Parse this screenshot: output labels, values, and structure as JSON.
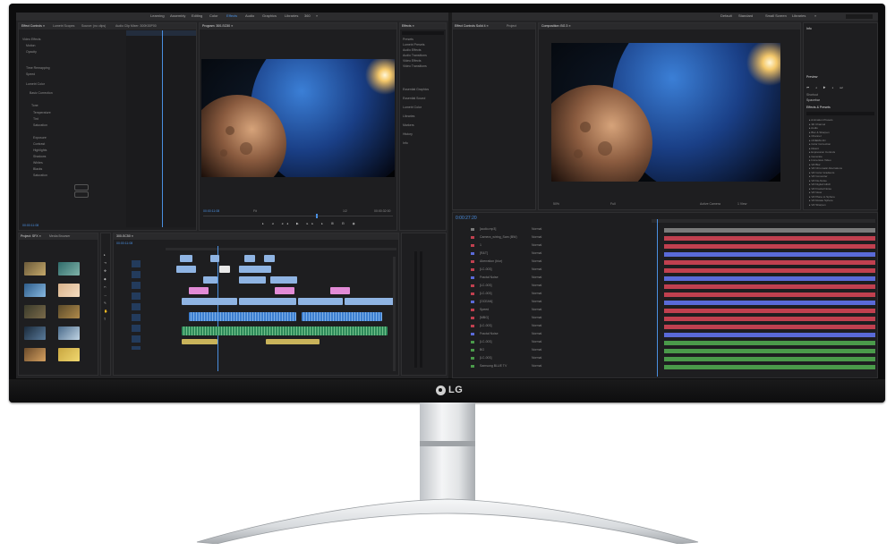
{
  "brand": {
    "logo_text": "LG"
  },
  "premiere": {
    "menu": [
      "Learning",
      "Assembly",
      "Editing",
      "Color",
      "Effects",
      "Audio",
      "Graphics",
      "Libraries",
      "360",
      "»"
    ],
    "effect_controls": {
      "tabs": [
        "Effect Controls ≡",
        "Lumetri Scopes",
        "Source: (no clips)",
        "Audio Clip Mixer: 300K00P00"
      ],
      "rows": [
        "Video Effects",
        "Motion",
        "Opacity",
        "Time Remapping",
        "Speed",
        "Lumetri Color",
        "Basic Correction",
        "Tone",
        "Temperature",
        "Tint",
        "Saturation",
        "Exposure",
        "Contrast",
        "Highlights",
        "Shadows",
        "Whites",
        "Blacks",
        "Saturation"
      ],
      "timecode": "00:00:11:08"
    },
    "program": {
      "tab": "Program: 300-SC50 ≡",
      "timecode_left": "00:00:11:08",
      "fit": "Fit",
      "ratio": "1/2",
      "timecode_right": "00:00:32:00"
    },
    "effects": {
      "tab": "Effects ≡",
      "items": [
        "Presets",
        "Lumetri Presets",
        "Audio Effects",
        "Audio Transitions",
        "Video Effects",
        "Video Transitions"
      ],
      "sections": [
        "Essential Graphics",
        "Essential Sound",
        "Lumetri Color",
        "Libraries",
        "Markers",
        "History",
        "Info"
      ]
    },
    "project": {
      "tabs": [
        "Project: SFX ≡",
        "Media Browser"
      ],
      "thumbs": [
        "clip_01",
        "clip_02",
        "clip_03",
        "clip_04",
        "clip_05",
        "clip_06",
        "clip_07",
        "clip_08",
        "clip_09",
        "clip_10"
      ]
    },
    "timeline": {
      "tab": "300-SC50 ≡",
      "timecode": "00:00:11:08",
      "tracks": [
        "V3",
        "V2",
        "V1",
        "A1",
        "A2",
        "A3"
      ]
    }
  },
  "after_effects": {
    "menu": [
      "Default",
      "Standard",
      "Small Screen",
      "Libraries",
      "»"
    ],
    "project_tabs": [
      "Effect Controls Solid 4 ≡",
      "Project"
    ],
    "comp_tab": "Composition: BG 3 ≡",
    "comp_zoom": "50%",
    "comp_quality": "Full",
    "comp_camera": "Active Camera",
    "comp_view": "1 View",
    "info_panel": "Info",
    "preview_panel": "Preview",
    "shortcut": "Shortcut",
    "shortcut_value": "Spacebar",
    "effects_presets": "Effects & Presets",
    "effect_categories": [
      "Animation Presets",
      "3D Channel",
      "Audio",
      "Blur & Sharpen",
      "Channel",
      "CINEMA 4D",
      "Color Correction",
      "Distort",
      "Expression Controls",
      "Generate",
      "Immersive Video",
      "VR Blur",
      "VR Chromatic Aberrations",
      "VR Color Gradients",
      "VR Converter",
      "VR De-Noise",
      "VR Digital Glitch",
      "VR Fractal Noise",
      "VR Glow",
      "VR Plane to Sphere",
      "VR Rotate Sphere",
      "VR Sharpen"
    ],
    "timeline_time": "0:00:27:20",
    "layer_names": [
      "[audio.mp3]",
      "Camera_wiring_Sam (BW)",
      "1",
      "[R&T]",
      "Aberration (blur)",
      "[LC-003]",
      "Fractal Noise",
      "[LC-003]",
      "[LC-003]",
      "[OCEAN]",
      "Speed",
      "[MBG]",
      "[LC-003]",
      "Fractal Noise",
      "[LC-003]",
      "BG",
      "[LC-003]",
      "Samsung BLUE TV"
    ],
    "mode": "Normal"
  }
}
